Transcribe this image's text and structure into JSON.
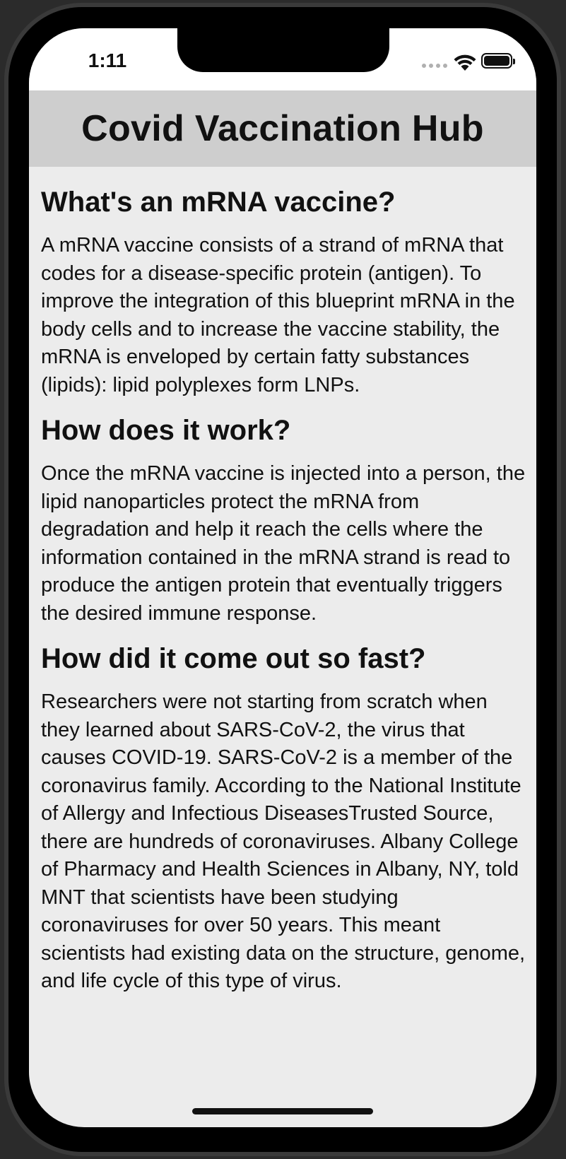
{
  "status_bar": {
    "time": "1:11"
  },
  "header": {
    "title": "Covid Vaccination Hub"
  },
  "sections": [
    {
      "heading": "What's an mRNA vaccine?",
      "body": "A mRNA vaccine consists of a strand of mRNA that codes for a disease-specific protein (antigen). To improve the integration of this blueprint mRNA in the body cells and to increase the vaccine stability, the mRNA is enveloped by certain fatty substances (lipids): lipid polyplexes form LNPs."
    },
    {
      "heading": "How does it work?",
      "body": "Once the mRNA vaccine is injected into a person, the lipid nanoparticles protect the mRNA from degradation and help it reach the cells where the information contained in the mRNA strand is read to produce the antigen protein that eventually triggers the desired immune response."
    },
    {
      "heading": "How did it come out so fast?",
      "body": "Researchers were not starting from scratch when they learned about SARS-CoV-2, the virus that causes COVID-19. SARS-CoV-2 is a member of the coronavirus family. According to the National Institute of Allergy and Infectious DiseasesTrusted Source, there are hundreds of coronaviruses. Albany College of Pharmacy and Health Sciences in Albany, NY, told MNT that scientists have been studying coronaviruses for over 50 years. This meant scientists had existing data on the structure, genome, and life cycle of this type of virus."
    }
  ],
  "icons": {
    "wifi": "wifi-icon",
    "battery": "battery-icon",
    "signal": "signal-icon"
  },
  "colors": {
    "header_bg": "#cecece",
    "content_bg": "#ececec",
    "text": "#111111"
  }
}
